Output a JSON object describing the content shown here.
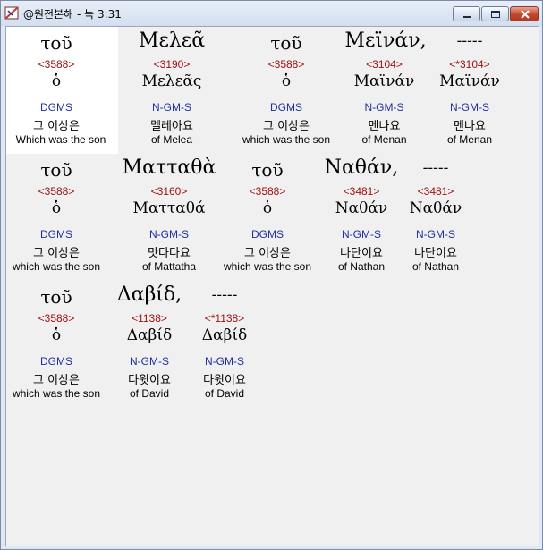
{
  "window": {
    "title": "@원전본해 - 눅 3:31"
  },
  "rows": [
    {
      "words": [
        {
          "greek": "τοῦ",
          "strong": "<3588>",
          "lemma": "ὁ",
          "morph": "DGMS",
          "korean": "그 이상은",
          "english": "Which was the son"
        },
        {
          "greek": "Μελεᾶ",
          "strong": "<3190>",
          "lemma": "Μελεᾶς",
          "morph": "N-GM-S",
          "korean": "멜레아요",
          "english": "of Melea"
        },
        {
          "greek": "τοῦ",
          "strong": "<3588>",
          "lemma": "ὁ",
          "morph": "DGMS",
          "korean": "그 이상은",
          "english": "which was the son"
        },
        {
          "greek": "Μεϊνάν,",
          "strong": "<3104>",
          "lemma": "Μαϊνάν",
          "morph": "N-GM-S",
          "korean": "멘나요",
          "english": "of Menan"
        },
        {
          "greek": "-----",
          "strong": "<*3104>",
          "lemma": "Μαϊνάν",
          "morph": "N-GM-S",
          "korean": "멘나요",
          "english": "of Menan"
        }
      ]
    },
    {
      "words": [
        {
          "greek": "τοῦ",
          "strong": "<3588>",
          "lemma": "ὁ",
          "morph": "DGMS",
          "korean": "그 이상은",
          "english": "which was the son"
        },
        {
          "greek": "Ματταθὰ",
          "strong": "<3160>",
          "lemma": "Ματταθά",
          "morph": "N-GM-S",
          "korean": "맛다다요",
          "english": "of Mattatha"
        },
        {
          "greek": "τοῦ",
          "strong": "<3588>",
          "lemma": "ὁ",
          "morph": "DGMS",
          "korean": "그 이상은",
          "english": "which was the son"
        },
        {
          "greek": "Ναθάν,",
          "strong": "<3481>",
          "lemma": "Ναθάν",
          "morph": "N-GM-S",
          "korean": "나단이요",
          "english": "of Nathan"
        },
        {
          "greek": "-----",
          "strong": "<3481>",
          "lemma": "Ναθάν",
          "morph": "N-GM-S",
          "korean": "나단이요",
          "english": "of Nathan"
        }
      ]
    },
    {
      "words": [
        {
          "greek": "τοῦ",
          "strong": "<3588>",
          "lemma": "ὁ",
          "morph": "DGMS",
          "korean": "그 이상은",
          "english": "which was the son"
        },
        {
          "greek": "Δαβίδ,",
          "strong": "<1138>",
          "lemma": "Δαβίδ",
          "morph": "N-GM-S",
          "korean": "다윗이요",
          "english": "of David"
        },
        {
          "greek": "-----",
          "strong": "<*1138>",
          "lemma": "Δαβίδ",
          "morph": "N-GM-S",
          "korean": "다윗이요",
          "english": "of David"
        }
      ]
    }
  ]
}
